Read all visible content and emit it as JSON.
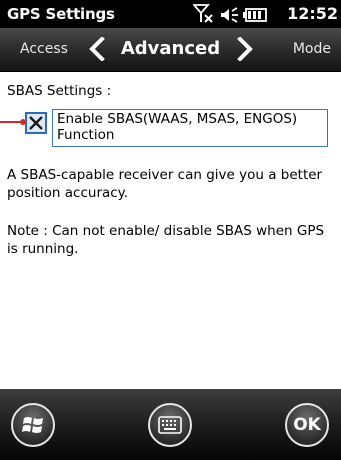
{
  "status_bar": {
    "app_title": "GPS Settings",
    "time": "12:52",
    "icons": [
      "signal-off-icon",
      "speaker-icon",
      "battery-icon"
    ]
  },
  "tabs": {
    "previous": "Access",
    "current": "Advanced",
    "next": "Mode"
  },
  "content": {
    "section_label": "SBAS Settings :",
    "checkbox": {
      "label": "Enable SBAS(WAAS, MSAS, ENGOS) Function",
      "checked": true
    },
    "description": "A SBAS-capable receiver can give you a better position accuracy.",
    "note": "Note : Can not enable/ disable SBAS when GPS is running."
  },
  "bottom_bar": {
    "ok_label": "OK",
    "icons": [
      "windows-start-icon",
      "keyboard-icon"
    ]
  },
  "colors": {
    "status_bar_bg": "#000000",
    "tab_strip_bg": "#2e2e2e",
    "checkbox_border": "#2b6bbf",
    "callout_line": "#d22b2b",
    "bottom_bar_bg": "#1d1d1d"
  }
}
